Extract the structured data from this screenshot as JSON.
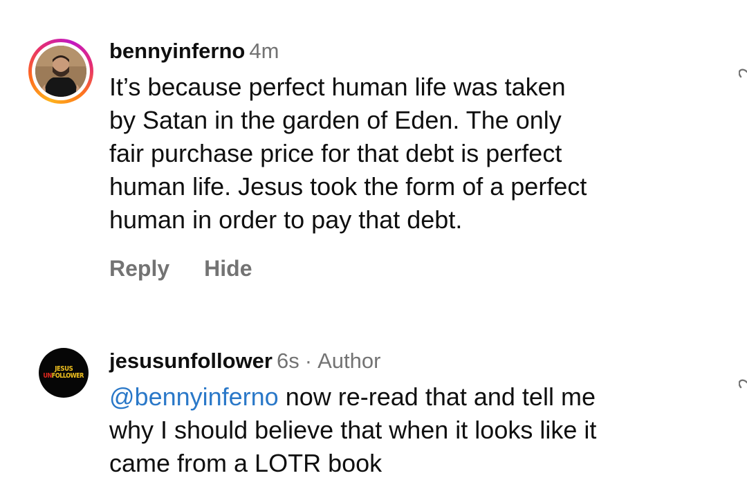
{
  "comments": [
    {
      "username": "bennyinferno",
      "time": "4m",
      "lines": [
        "It’s because perfect human life was taken",
        "by Satan in the garden of Eden. The only",
        "fair purchase price for that debt is perfect",
        "human life. Jesus took the form of a perfect",
        "human in order to pay that debt."
      ],
      "reply_label": "Reply",
      "hide_label": "Hide"
    },
    {
      "username": "jesusunfollower",
      "time": "6s",
      "separator": "·",
      "badge": "Author",
      "mention": "@bennyinferno",
      "lines": [
        " now re-read that and tell me",
        "why I should believe that when it looks like it",
        "came from a LOTR book"
      ],
      "avatar_logo": {
        "line1": "JESUS",
        "line2_a": "UN",
        "line2_b": "FOLLOWER"
      }
    }
  ],
  "colors": {
    "text": "#0f0f0f",
    "muted": "#737373",
    "mention": "#2a78c8",
    "ring_start": "#fdb21e",
    "ring_end": "#c218c4"
  },
  "icons": {
    "like": "heart-icon",
    "avatar1": "avatar",
    "avatar2": "avatar"
  }
}
